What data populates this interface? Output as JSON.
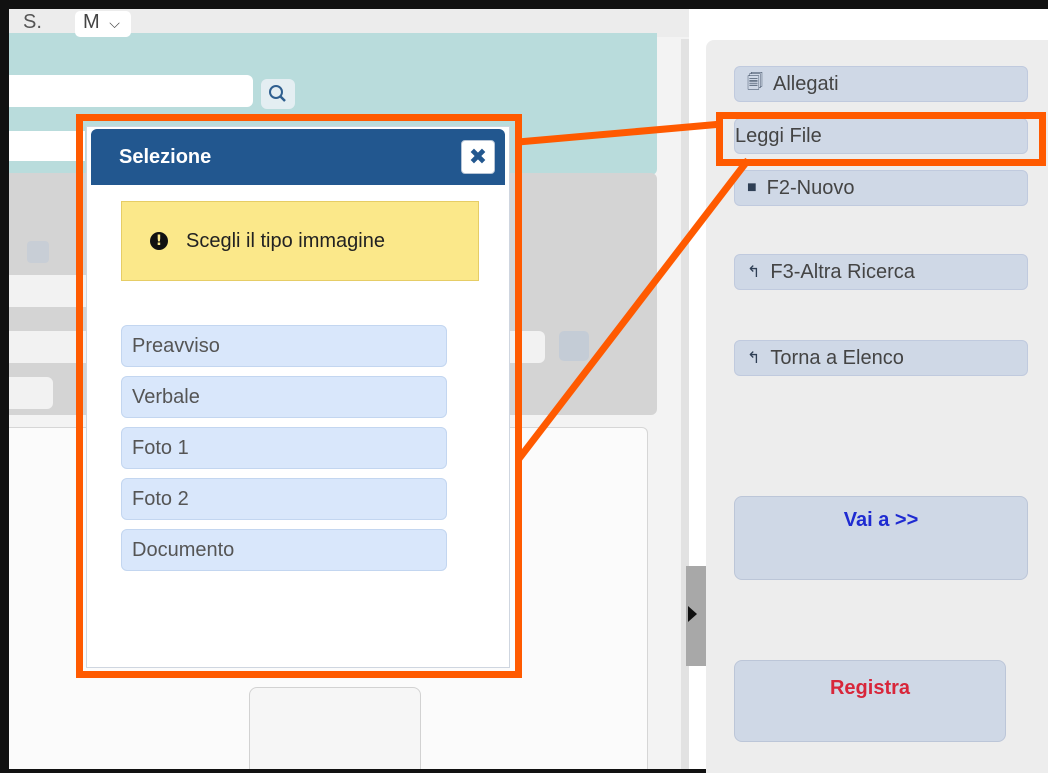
{
  "background": {
    "s_label": "S.",
    "m_select": "M",
    "icons": {
      "search": "search-icon",
      "calculator": "calculator-icon",
      "collapse": "chevron-right-icon"
    }
  },
  "actions": {
    "allegati": {
      "label": "Allegati",
      "icon": "paperclip-files-icon"
    },
    "leggi_file": {
      "label": "Leggi File"
    },
    "nuovo": {
      "label": "F2-Nuovo",
      "icon": "file-icon"
    },
    "altra_ricerca": {
      "label": "F3-Altra Ricerca",
      "icon": "undo-arrow-icon"
    },
    "torna_elenco": {
      "label": "Torna a Elenco",
      "icon": "undo-arrow-icon"
    },
    "vai_a": {
      "label": "Vai a >>",
      "color": "#1f2bd1"
    },
    "registra": {
      "label": "Registra",
      "color": "#d8263a"
    }
  },
  "dialog": {
    "title": "Selezione",
    "close_icon": "close-icon",
    "warning": {
      "text": "Scegli il tipo immagine",
      "icon": "exclamation-circle-icon"
    },
    "options": [
      "Preavviso",
      "Verbale",
      "Foto 1",
      "Foto 2",
      "Documento"
    ]
  },
  "highlight_color": "#ff5a00"
}
